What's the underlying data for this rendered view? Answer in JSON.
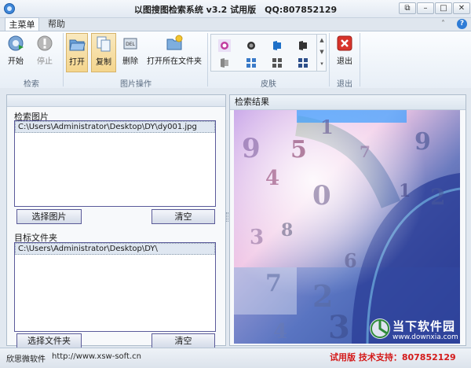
{
  "window": {
    "title": "以图搜图检索系统 v3.2 试用版　QQ:807852129"
  },
  "tabs": [
    {
      "label": "主菜单"
    },
    {
      "label": "帮助"
    }
  ],
  "ribbon": {
    "search_group": {
      "label": "检索",
      "start": "开始",
      "stop": "停止"
    },
    "image_ops_group": {
      "label": "图片操作",
      "open": "打开",
      "copy": "复制",
      "delete": "删除",
      "open_folder": "打开所在文件夹"
    },
    "skin_group": {
      "label": "皮肤"
    },
    "exit_group": {
      "label": "退出",
      "exit": "退出"
    }
  },
  "left_panel": {
    "search_image": {
      "label": "检索图片",
      "items": [
        "C:\\Users\\Administrator\\Desktop\\DY\\dy001.jpg"
      ],
      "select_button": "选择图片",
      "clear_button": "清空"
    },
    "target_folder": {
      "label": "目标文件夹",
      "items": [
        "C:\\Users\\Administrator\\Desktop\\DY\\"
      ],
      "select_button": "选择文件夹",
      "clear_button": "清空"
    }
  },
  "results": {
    "title": "检索结果"
  },
  "statusbar": {
    "company": "欣思微软件",
    "url": "http://www.xsw-soft.cn",
    "trial": "试用版 技术支持：807852129"
  },
  "watermark": {
    "text": "当下软件园",
    "url": "www.downxia.com"
  },
  "colors": {
    "accent": "#2f7cd6",
    "trial_red": "#d41a1a",
    "button_border": "#5b5b99",
    "panel_border": "#aebccb"
  }
}
